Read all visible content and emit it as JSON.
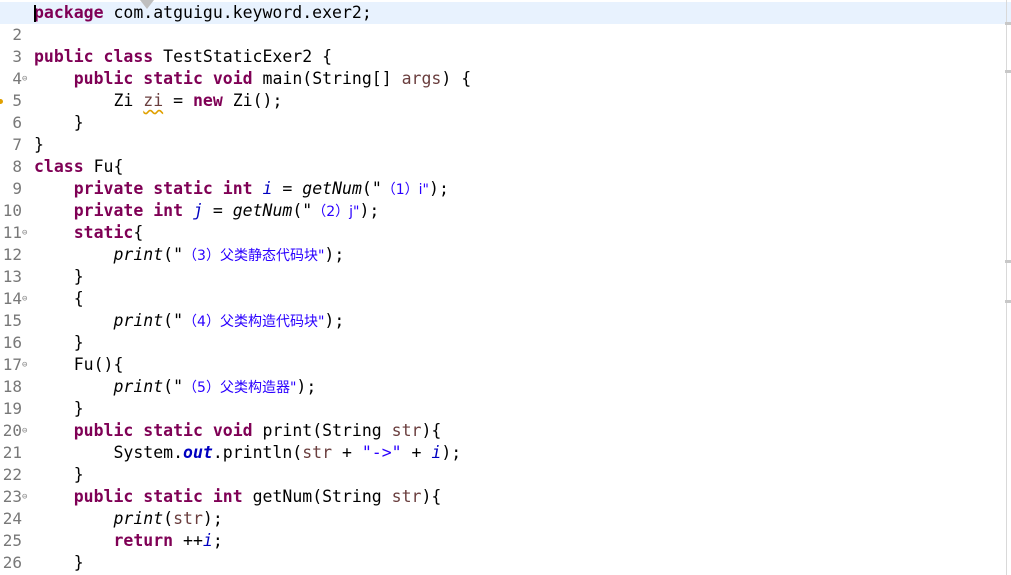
{
  "editor": {
    "gutter": [
      "1",
      "2",
      "3",
      "4",
      "5",
      "6",
      "7",
      "8",
      "9",
      "10",
      "11",
      "12",
      "13",
      "14",
      "15",
      "16",
      "17",
      "18",
      "19",
      "20",
      "21",
      "22",
      "23",
      "24",
      "25",
      "26"
    ],
    "fold_markers": [
      "4",
      "11",
      "14",
      "17",
      "20",
      "23"
    ],
    "lines": [
      [
        {
          "t": "package",
          "c": "kw"
        },
        {
          "t": " com.atguigu.keyword.exer2;"
        }
      ],
      [],
      [
        {
          "t": "public",
          "c": "kw"
        },
        {
          "t": " "
        },
        {
          "t": "class",
          "c": "kw"
        },
        {
          "t": " TestStaticExer2 {"
        }
      ],
      [
        {
          "t": "    "
        },
        {
          "t": "public",
          "c": "kw"
        },
        {
          "t": " "
        },
        {
          "t": "static",
          "c": "kw"
        },
        {
          "t": " "
        },
        {
          "t": "void",
          "c": "kw"
        },
        {
          "t": " main(String[] "
        },
        {
          "t": "args",
          "c": "par"
        },
        {
          "t": ") {"
        }
      ],
      [
        {
          "t": "        Zi "
        },
        {
          "t": "zi",
          "c": "unused"
        },
        {
          "t": " = "
        },
        {
          "t": "new",
          "c": "kw"
        },
        {
          "t": " Zi();"
        }
      ],
      [
        {
          "t": "    }"
        }
      ],
      [
        {
          "t": "}"
        }
      ],
      [
        {
          "t": "class",
          "c": "kw"
        },
        {
          "t": " Fu{"
        }
      ],
      [
        {
          "t": "    "
        },
        {
          "t": "private",
          "c": "kw"
        },
        {
          "t": " "
        },
        {
          "t": "static",
          "c": "kw"
        },
        {
          "t": " "
        },
        {
          "t": "int",
          "c": "kw"
        },
        {
          "t": " "
        },
        {
          "t": "i",
          "c": "fld"
        },
        {
          "t": " = "
        },
        {
          "t": "getNum",
          "c": "it"
        },
        {
          "t": "(\"",
          "c": ""
        },
        {
          "t": "（1）i\"",
          "c": "st"
        },
        {
          "t": ");"
        }
      ],
      [
        {
          "t": "    "
        },
        {
          "t": "private",
          "c": "kw"
        },
        {
          "t": " "
        },
        {
          "t": "int",
          "c": "kw"
        },
        {
          "t": " "
        },
        {
          "t": "j",
          "c": "fld"
        },
        {
          "t": " = "
        },
        {
          "t": "getNum",
          "c": "it"
        },
        {
          "t": "(\""
        },
        {
          "t": "（2）j\"",
          "c": "st"
        },
        {
          "t": ");"
        }
      ],
      [
        {
          "t": "    "
        },
        {
          "t": "static",
          "c": "kw"
        },
        {
          "t": "{"
        }
      ],
      [
        {
          "t": "        "
        },
        {
          "t": "print",
          "c": "it"
        },
        {
          "t": "(\""
        },
        {
          "t": "（3）父类静态代码块\"",
          "c": "st"
        },
        {
          "t": ");"
        }
      ],
      [
        {
          "t": "    }"
        }
      ],
      [
        {
          "t": "    {"
        }
      ],
      [
        {
          "t": "        "
        },
        {
          "t": "print",
          "c": "it"
        },
        {
          "t": "(\""
        },
        {
          "t": "（4）父类构造代码块\"",
          "c": "st"
        },
        {
          "t": ");"
        }
      ],
      [
        {
          "t": "    }"
        }
      ],
      [
        {
          "t": "    Fu(){"
        }
      ],
      [
        {
          "t": "        "
        },
        {
          "t": "print",
          "c": "it"
        },
        {
          "t": "(\""
        },
        {
          "t": "（5）父类构造器\"",
          "c": "st"
        },
        {
          "t": ");"
        }
      ],
      [
        {
          "t": "    }"
        }
      ],
      [
        {
          "t": "    "
        },
        {
          "t": "public",
          "c": "kw"
        },
        {
          "t": " "
        },
        {
          "t": "static",
          "c": "kw"
        },
        {
          "t": " "
        },
        {
          "t": "void",
          "c": "kw"
        },
        {
          "t": " print(String "
        },
        {
          "t": "str",
          "c": "par"
        },
        {
          "t": "){"
        }
      ],
      [
        {
          "t": "        System."
        },
        {
          "t": "out",
          "c": "fldb"
        },
        {
          "t": ".println("
        },
        {
          "t": "str",
          "c": "par"
        },
        {
          "t": " + "
        },
        {
          "t": "\"->\"",
          "c": "st"
        },
        {
          "t": " + "
        },
        {
          "t": "i",
          "c": "fld"
        },
        {
          "t": ");"
        }
      ],
      [
        {
          "t": "    }"
        }
      ],
      [
        {
          "t": "    "
        },
        {
          "t": "public",
          "c": "kw"
        },
        {
          "t": " "
        },
        {
          "t": "static",
          "c": "kw"
        },
        {
          "t": " "
        },
        {
          "t": "int",
          "c": "kw"
        },
        {
          "t": " getNum(String "
        },
        {
          "t": "str",
          "c": "par"
        },
        {
          "t": "){"
        }
      ],
      [
        {
          "t": "        "
        },
        {
          "t": "print",
          "c": "it"
        },
        {
          "t": "("
        },
        {
          "t": "str",
          "c": "par"
        },
        {
          "t": ");"
        }
      ],
      [
        {
          "t": "        "
        },
        {
          "t": "return",
          "c": "kw"
        },
        {
          "t": " ++"
        },
        {
          "t": "i",
          "c": "fld"
        },
        {
          "t": ";"
        }
      ],
      [
        {
          "t": "    }"
        }
      ]
    ]
  }
}
